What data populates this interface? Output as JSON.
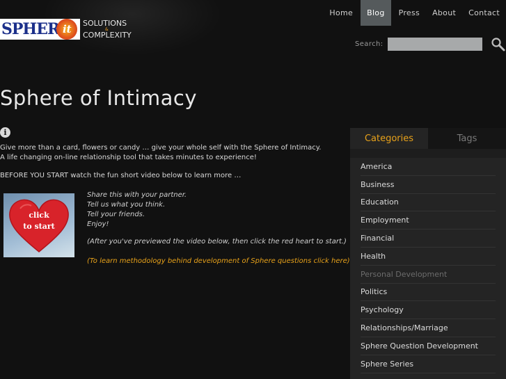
{
  "logo": {
    "main": "SPHER",
    "it": "it",
    "line1": "SOLUTIONS",
    "amp": "&",
    "line2": "COMPLEXITY"
  },
  "nav": {
    "items": [
      {
        "label": "Home",
        "active": false
      },
      {
        "label": "Blog",
        "active": true
      },
      {
        "label": "Press",
        "active": false
      },
      {
        "label": "About",
        "active": false
      },
      {
        "label": "Contact",
        "active": false
      }
    ]
  },
  "search": {
    "label": "Search:",
    "value": "",
    "placeholder": ""
  },
  "page": {
    "title": "Sphere of Intimacy",
    "info_icon": "info-icon",
    "intro_line1": "Give more than a card, flowers or candy … give your whole self with the Sphere of Intimacy.",
    "intro_line2": "A life changing on-line relationship tool that takes minutes to experience!",
    "before": "BEFORE YOU START watch the fun short video below to learn more …",
    "heart_line1": "click",
    "heart_line2": "to start",
    "share": [
      "Share this with your partner.",
      "Tell us what you think.",
      "Tell your friends.",
      "Enjoy!"
    ],
    "note": "(After you've previewed the video below, then click the red heart to start.)",
    "method_link": "(To learn methodology behind development of Sphere questions click here)"
  },
  "sidebar": {
    "tabs": [
      {
        "label": "Categories",
        "active": true
      },
      {
        "label": "Tags",
        "active": false
      }
    ],
    "categories": [
      {
        "label": "America",
        "dim": false
      },
      {
        "label": "Business",
        "dim": false
      },
      {
        "label": "Education",
        "dim": false
      },
      {
        "label": "Employment",
        "dim": false
      },
      {
        "label": "Financial",
        "dim": false
      },
      {
        "label": "Health",
        "dim": false
      },
      {
        "label": "Personal Development",
        "dim": true
      },
      {
        "label": "Politics",
        "dim": false
      },
      {
        "label": "Psychology",
        "dim": false
      },
      {
        "label": "Relationships/Marriage",
        "dim": false
      },
      {
        "label": "Sphere Question Development",
        "dim": false
      },
      {
        "label": "Sphere Series",
        "dim": false
      }
    ]
  },
  "colors": {
    "background": "#111111",
    "accent": "#e8a21a",
    "nav_active": "#555a5c"
  }
}
